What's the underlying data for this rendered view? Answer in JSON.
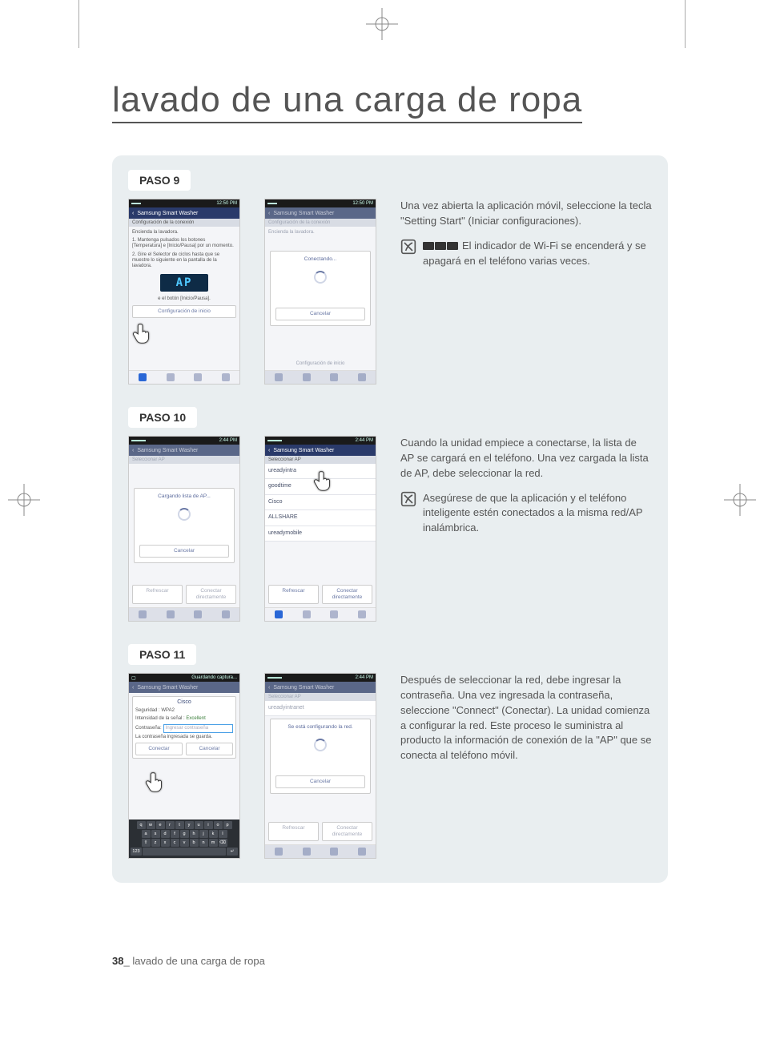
{
  "title": "lavado de una carga de ropa",
  "footer": {
    "page_num": "38",
    "sep": "_ ",
    "running": "lavado de una carga de ropa"
  },
  "steps": {
    "s9": {
      "pill": "PASO 9",
      "desc": "Una vez abierta la aplicación móvil, seleccione la tecla \"Setting Start\" (Iniciar configuraciones).",
      "note": "El indicador de Wi-Fi se encenderá y se apagará en el teléfono varias veces.",
      "left": {
        "time": "12:50 PM",
        "app_title": "Samsung Smart Washer",
        "subbar": "Configuración de la conexión",
        "line_top": "Encienda la lavadora.",
        "line1": "1. Mantenga pulsados los botones [Temperatura] e [Inicio/Pausa] por un momento.",
        "line2": "2. Gire el Selector de ciclos hasta que se muestre lo siguiente en la pantalla de la lavadora.",
        "ap": "AP",
        "btn_line": "e el botón [Inicio/Pausa].",
        "footer_btn": "Configuración de inicio"
      },
      "right": {
        "time": "12:50 PM",
        "app_title": "Samsung Smart Washer",
        "subbar": "Configuración de la conexión",
        "body_dim": "Encienda la lavadora.",
        "modal_title": "Conectando...",
        "cancel": "Cancelar",
        "footer_btn": "Configuración de inicio"
      }
    },
    "s10": {
      "pill": "PASO 10",
      "desc": "Cuando la unidad empiece a conectarse, la lista de AP se cargará en el teléfono. Una vez cargada la lista de AP, debe seleccionar la red.",
      "note": "Asegúrese de que la aplicación y el teléfono inteligente estén conectados a la misma red/AP inalámbrica.",
      "left": {
        "time": "2:44 PM",
        "app_title": "Samsung Smart Washer",
        "subbar": "Seleccionar AP",
        "modal_title": "Cargando lista de AP...",
        "cancel": "Cancelar",
        "btn_l": "Refrescar",
        "btn_r": "Conectar directamente"
      },
      "right": {
        "time": "2:44 PM",
        "app_title": "Samsung Smart Washer",
        "subbar": "Seleccionar AP",
        "items": [
          "ureadyintra",
          "goodtime",
          "Cisco",
          "ALLSHARE",
          "ureadymobile"
        ],
        "btn_l": "Refrescar",
        "btn_r": "Conectar directamente"
      }
    },
    "s11": {
      "pill": "PASO 11",
      "desc": "Después de seleccionar la red, debe ingresar la contraseña. Una vez ingresada la contraseña, seleccione \"Connect\" (Conectar). La unidad comienza a configurar la red. Este proceso le suministra al producto la información de conexión de la \"AP\" que se conecta al teléfono móvil.",
      "left": {
        "saving": "Guardando captura...",
        "app_title": "Samsung Smart Washer",
        "net": "Cisco",
        "sec_lbl": "Seguridad :",
        "sec_val": "WPA2",
        "sig_lbl": "Intensidad de la señal :",
        "sig_val": "Excellent",
        "pw_lbl": "Contraseña:",
        "pw_ph": "Ingresar contraseña",
        "pw_note": "La contraseña ingresada se guarda.",
        "btn_l": "Conectar",
        "btn_r": "Cancelar",
        "kb_r1": [
          "q",
          "w",
          "e",
          "r",
          "t",
          "y",
          "u",
          "i",
          "o",
          "p"
        ],
        "kb_r2": [
          "a",
          "s",
          "d",
          "f",
          "g",
          "h",
          "j",
          "k",
          "l"
        ],
        "kb_r3": [
          "⇧",
          "z",
          "x",
          "c",
          "v",
          "b",
          "n",
          "m",
          "⌫"
        ]
      },
      "right": {
        "time": "2:44 PM",
        "app_title": "Samsung Smart Washer",
        "subbar": "Seleccionar AP",
        "top_item": "ureadyintranet",
        "modal_title": "Se está configurando la red.",
        "cancel": "Cancelar",
        "btn_l": "Refrescar",
        "btn_r": "Conectar directamente"
      }
    }
  }
}
